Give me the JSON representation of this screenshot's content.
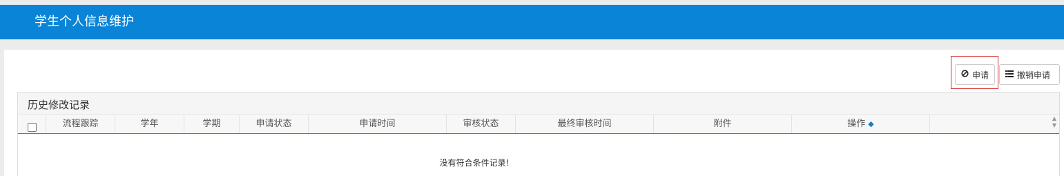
{
  "page": {
    "title": "学生个人信息维护"
  },
  "toolbar": {
    "apply_label": "申请",
    "apply_icon": "ban-icon",
    "cancel_label": "撤销申请",
    "cancel_icon": "list-icon"
  },
  "table": {
    "caption": "历史修改记录",
    "columns": [
      "流程跟踪",
      "学年",
      "学期",
      "申请状态",
      "申请时间",
      "审核状态",
      "最终审核时间",
      "附件",
      "操作",
      ""
    ],
    "empty_text": "没有符合条件记录!",
    "rows": []
  },
  "colors": {
    "header_bg": "#0a84d6",
    "highlight": "#d43030"
  }
}
